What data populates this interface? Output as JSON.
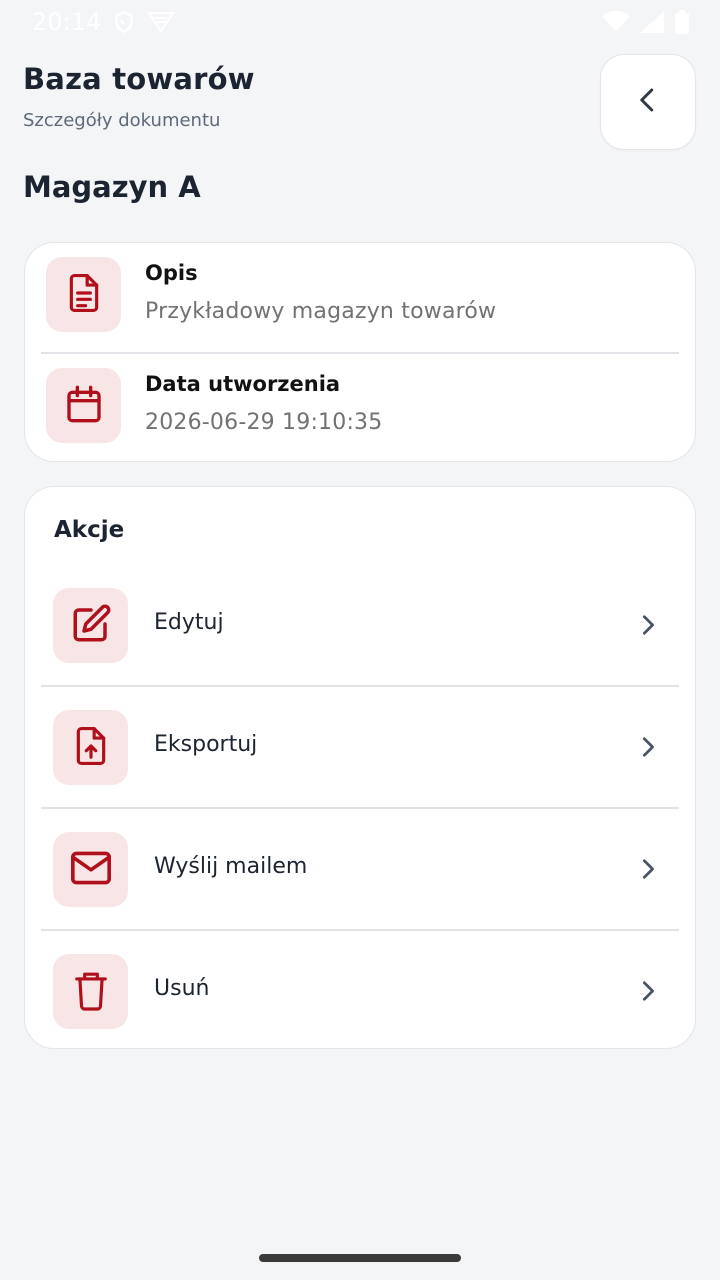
{
  "status_bar": {
    "time": "20:14"
  },
  "header": {
    "title": "Baza towarów",
    "subtitle": "Szczegóły dokumentu",
    "back_icon": "chevron-left-icon"
  },
  "section": {
    "title": "Magazyn A"
  },
  "details": [
    {
      "label": "Opis",
      "value": "Przykładowy magazyn towarów",
      "icon": "document-icon"
    },
    {
      "label": "Data utworzenia",
      "value": "2026-06-29 19:10:35",
      "icon": "calendar-icon"
    }
  ],
  "actions": {
    "title": "Akcje",
    "items": [
      {
        "label": "Edytuj",
        "icon": "edit-icon"
      },
      {
        "label": "Eksportuj",
        "icon": "file-export-icon"
      },
      {
        "label": "Wyślij mailem",
        "icon": "mail-icon"
      },
      {
        "label": "Usuń",
        "icon": "trash-icon"
      }
    ]
  },
  "colors": {
    "accent": "#b00f1c",
    "icon_tile_bg": "#f8e6e6",
    "page_bg": "#f4f5f7",
    "card_bg": "#ffffff"
  }
}
